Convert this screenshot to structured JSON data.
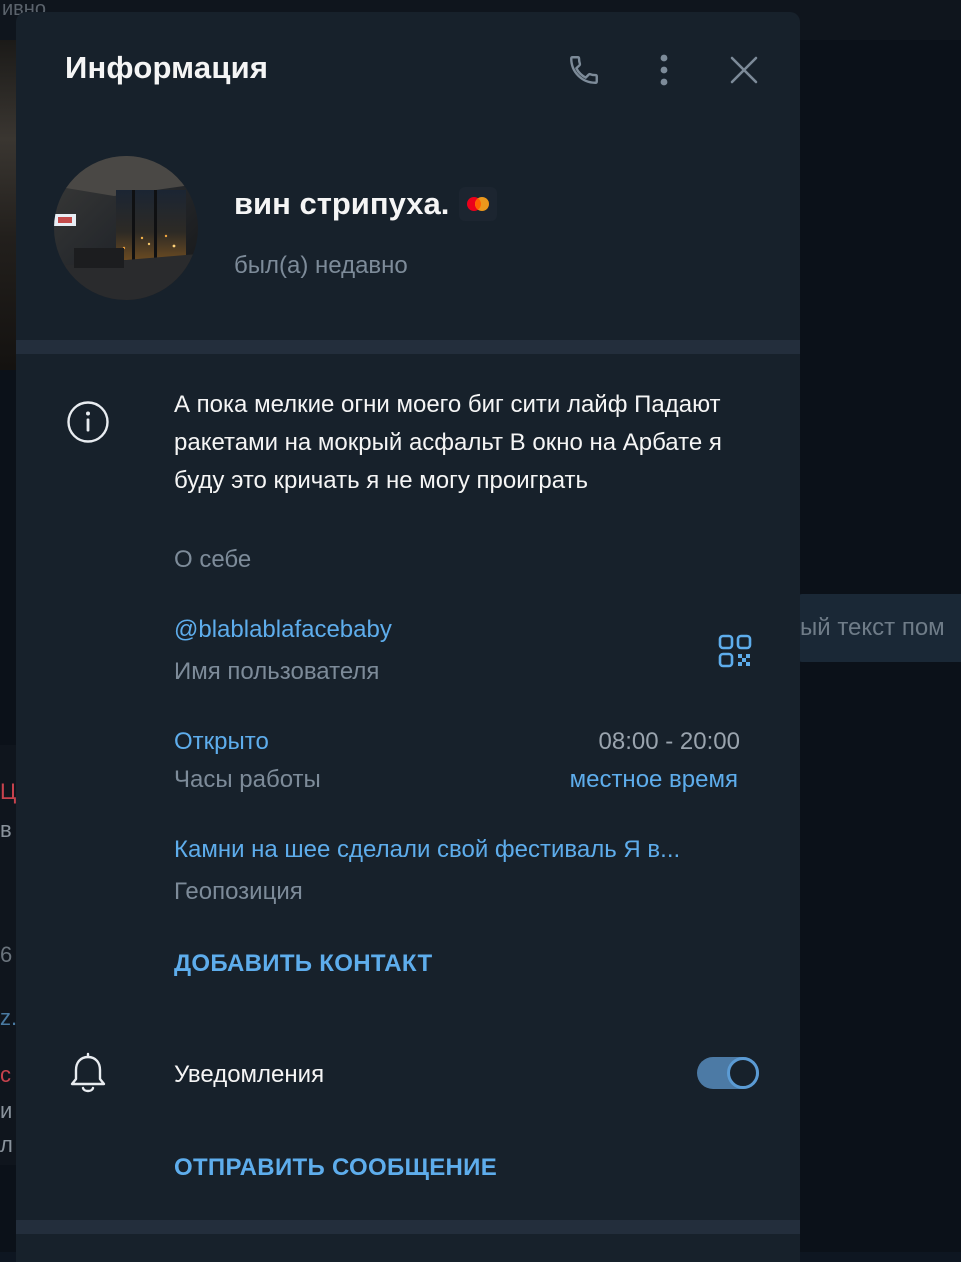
{
  "background": {
    "top_fragment": "ивно",
    "bubble_text": "ый текст пом",
    "left_fragments": [
      "Ц",
      "в",
      "6",
      "z.",
      "с",
      "и",
      "л"
    ]
  },
  "panel": {
    "title": "Информация",
    "header_buttons": [
      "phone-icon",
      "more-vertical-icon",
      "close-icon"
    ]
  },
  "profile": {
    "name": "вин стрипуха.",
    "status": "был(а) недавно"
  },
  "bio": {
    "text": "А пока мелкие огни моего биг сити лайф Падают ракетами на мокрый асфальт В окно на Арбате я буду это кричать я не могу проиграть",
    "label": "О себе"
  },
  "username": {
    "value": "@blablablafacebaby",
    "label": "Имя пользователя"
  },
  "hours": {
    "status": "Открыто",
    "label": "Часы работы",
    "time": "08:00 - 20:00",
    "timezone": "местное время"
  },
  "location": {
    "value": "Камни на шее сделали свой фестиваль Я в...",
    "label": "Геопозиция"
  },
  "actions": {
    "add_contact": "ДОБАВИТЬ КОНТАКТ",
    "send_message": "ОТПРАВИТЬ СООБЩЕНИЕ"
  },
  "notifications": {
    "label": "Уведомления",
    "enabled": true
  },
  "colors": {
    "panel_bg": "#17212b",
    "divider": "#232e3c",
    "accent": "#5eadec",
    "text_primary": "#f5f5f5",
    "text_secondary": "#7d8b99",
    "toggle_on": "#4c7aa5"
  }
}
